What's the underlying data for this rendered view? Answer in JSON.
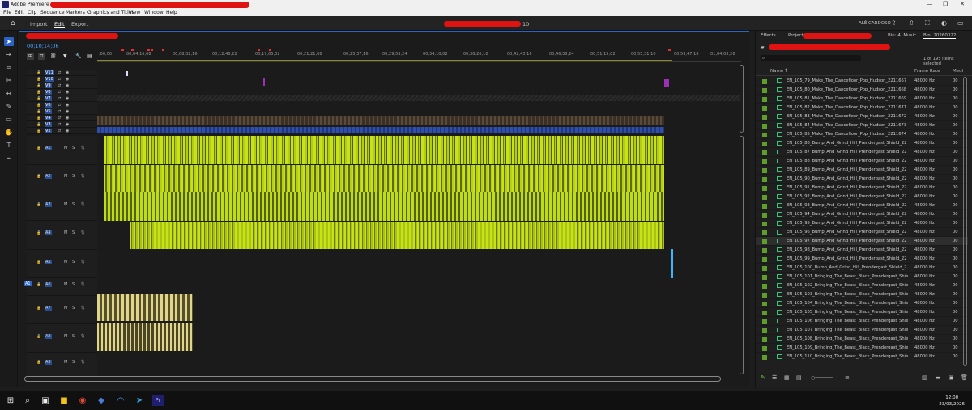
{
  "window": {
    "title": "Adobe Premiere - E",
    "min": "—",
    "max": "❐",
    "close": "✕"
  },
  "menu": [
    "File",
    "Edit",
    "Clip",
    "Sequence",
    "Markers",
    "Graphics and Titles",
    "View",
    "Window",
    "Help"
  ],
  "header": {
    "import": "Import",
    "edit": "Edit",
    "export": "Export",
    "project_suffix": "10",
    "user": "ALÊ CARDOSO"
  },
  "timeline": {
    "timecode": "00;10;14;06",
    "ruler_ticks": [
      ":00;00",
      "00;04;16;08",
      "00;08;32;16",
      "00;12;48;22",
      "00;17;05;02",
      "00;21;21;08",
      "00;25;37;16",
      "00;29;53;24",
      "00;34;10;02",
      "00;38;26;10",
      "00;42;43;16",
      "00;46;58;24",
      "00;51;15;02",
      "00;55;31;10",
      "00;59;47;18",
      "01;04;03;26"
    ],
    "video_tracks": [
      "V11",
      "V10",
      "V9",
      "V8",
      "V7",
      "V6",
      "V5",
      "V4",
      "V3",
      "V2"
    ],
    "audio_tracks": [
      "A1",
      "A2",
      "A3",
      "A4",
      "A5",
      "A6",
      "A7",
      "A8",
      "A9"
    ],
    "audio_controls": {
      "m": "M",
      "s": "S"
    },
    "source_patch": "A1"
  },
  "panel": {
    "tabs": {
      "effects": "Effects",
      "project": "Project:",
      "bin_music": "Bin: 4. Music",
      "bin_date": "Bin: 20260322"
    },
    "search_placeholder": "",
    "selection_count": "1 of 195 items selected",
    "columns": {
      "name": "Name",
      "frame_rate": "Frame Rate",
      "media": "Medi"
    },
    "items": [
      {
        "name": "EN_105_79_Make_The_Dancefloor_Pop_Hudson_2211667",
        "rate": "48000 Hz",
        "media": "00"
      },
      {
        "name": "EN_105_80_Make_The_Dancefloor_Pop_Hudson_2211668",
        "rate": "48000 Hz",
        "media": "00"
      },
      {
        "name": "EN_105_81_Make_The_Dancefloor_Pop_Hudson_2211669",
        "rate": "48000 Hz",
        "media": "00"
      },
      {
        "name": "EN_105_82_Make_The_Dancefloor_Pop_Hudson_2211671",
        "rate": "48000 Hz",
        "media": "00"
      },
      {
        "name": "EN_105_83_Make_The_Dancefloor_Pop_Hudson_2211672",
        "rate": "48000 Hz",
        "media": "00"
      },
      {
        "name": "EN_105_84_Make_The_Dancefloor_Pop_Hudson_2211673",
        "rate": "48000 Hz",
        "media": "00"
      },
      {
        "name": "EN_105_85_Make_The_Dancefloor_Pop_Hudson_2211674",
        "rate": "48000 Hz",
        "media": "00"
      },
      {
        "name": "EN_105_86_Bump_And_Grind_Hill_Prendergast_Shield_22",
        "rate": "48000 Hz",
        "media": "00"
      },
      {
        "name": "EN_105_87_Bump_And_Grind_Hill_Prendergast_Shield_22",
        "rate": "48000 Hz",
        "media": "00"
      },
      {
        "name": "EN_105_88_Bump_And_Grind_Hill_Prendergast_Shield_22",
        "rate": "48000 Hz",
        "media": "00"
      },
      {
        "name": "EN_105_89_Bump_And_Grind_Hill_Prendergast_Shield_22",
        "rate": "48000 Hz",
        "media": "00"
      },
      {
        "name": "EN_105_90_Bump_And_Grind_Hill_Prendergast_Shield_22",
        "rate": "48000 Hz",
        "media": "00"
      },
      {
        "name": "EN_105_91_Bump_And_Grind_Hill_Prendergast_Shield_22",
        "rate": "48000 Hz",
        "media": "00"
      },
      {
        "name": "EN_105_92_Bump_And_Grind_Hill_Prendergast_Shield_22",
        "rate": "48000 Hz",
        "media": "00"
      },
      {
        "name": "EN_105_93_Bump_And_Grind_Hill_Prendergast_Shield_22",
        "rate": "48000 Hz",
        "media": "00"
      },
      {
        "name": "EN_105_94_Bump_And_Grind_Hill_Prendergast_Shield_22",
        "rate": "48000 Hz",
        "media": "00"
      },
      {
        "name": "EN_105_95_Bump_And_Grind_Hill_Prendergast_Shield_22",
        "rate": "48000 Hz",
        "media": "00"
      },
      {
        "name": "EN_105_96_Bump_And_Grind_Hill_Prendergast_Shield_22",
        "rate": "48000 Hz",
        "media": "00"
      },
      {
        "name": "EN_105_97_Bump_And_Grind_Hill_Prendergast_Shield_22",
        "rate": "48000 Hz",
        "media": "00"
      },
      {
        "name": "EN_105_98_Bump_And_Grind_Hill_Prendergast_Shield_22",
        "rate": "48000 Hz",
        "media": "00"
      },
      {
        "name": "EN_105_99_Bump_And_Grind_Hill_Prendergast_Shield_22",
        "rate": "48000 Hz",
        "media": "00"
      },
      {
        "name": "EN_105_100_Bump_And_Grind_Hill_Prendergast_Shield_2",
        "rate": "48000 Hz",
        "media": "00"
      },
      {
        "name": "EN_105_101_Bringing_The_Beast_Black_Prendergast_Shiel",
        "rate": "48000 Hz",
        "media": "00"
      },
      {
        "name": "EN_105_102_Bringing_The_Beast_Black_Prendergast_Shiel",
        "rate": "48000 Hz",
        "media": "00"
      },
      {
        "name": "EN_105_103_Bringing_The_Beast_Black_Prendergast_Shiel",
        "rate": "48000 Hz",
        "media": "00"
      },
      {
        "name": "EN_105_104_Bringing_The_Beast_Black_Prendergast_Shiel",
        "rate": "48000 Hz",
        "media": "00"
      },
      {
        "name": "EN_105_105_Bringing_The_Beast_Black_Prendergast_Shiel",
        "rate": "48000 Hz",
        "media": "00"
      },
      {
        "name": "EN_105_106_Bringing_The_Beast_Black_Prendergast_Shiel",
        "rate": "48000 Hz",
        "media": "00"
      },
      {
        "name": "EN_105_107_Bringing_The_Beast_Black_Prendergast_Shiel",
        "rate": "48000 Hz",
        "media": "00"
      },
      {
        "name": "EN_105_108_Bringing_The_Beast_Black_Prendergast_Shiel",
        "rate": "48000 Hz",
        "media": "00"
      },
      {
        "name": "EN_105_109_Bringing_The_Beast_Black_Prendergast_Shiel",
        "rate": "48000 Hz",
        "media": "00"
      },
      {
        "name": "EN_105_110_Bringing_The_Beast_Black_Prendergast_Shiel",
        "rate": "48000 Hz",
        "media": "00"
      }
    ]
  },
  "taskbar": {
    "time": "12:00",
    "date": "23/03/2026"
  },
  "colors": {
    "accent": "#2b64c8",
    "audio_clip": "#c8e21a",
    "timecode": "#4da3ff",
    "playhead": "#4d8cff"
  }
}
